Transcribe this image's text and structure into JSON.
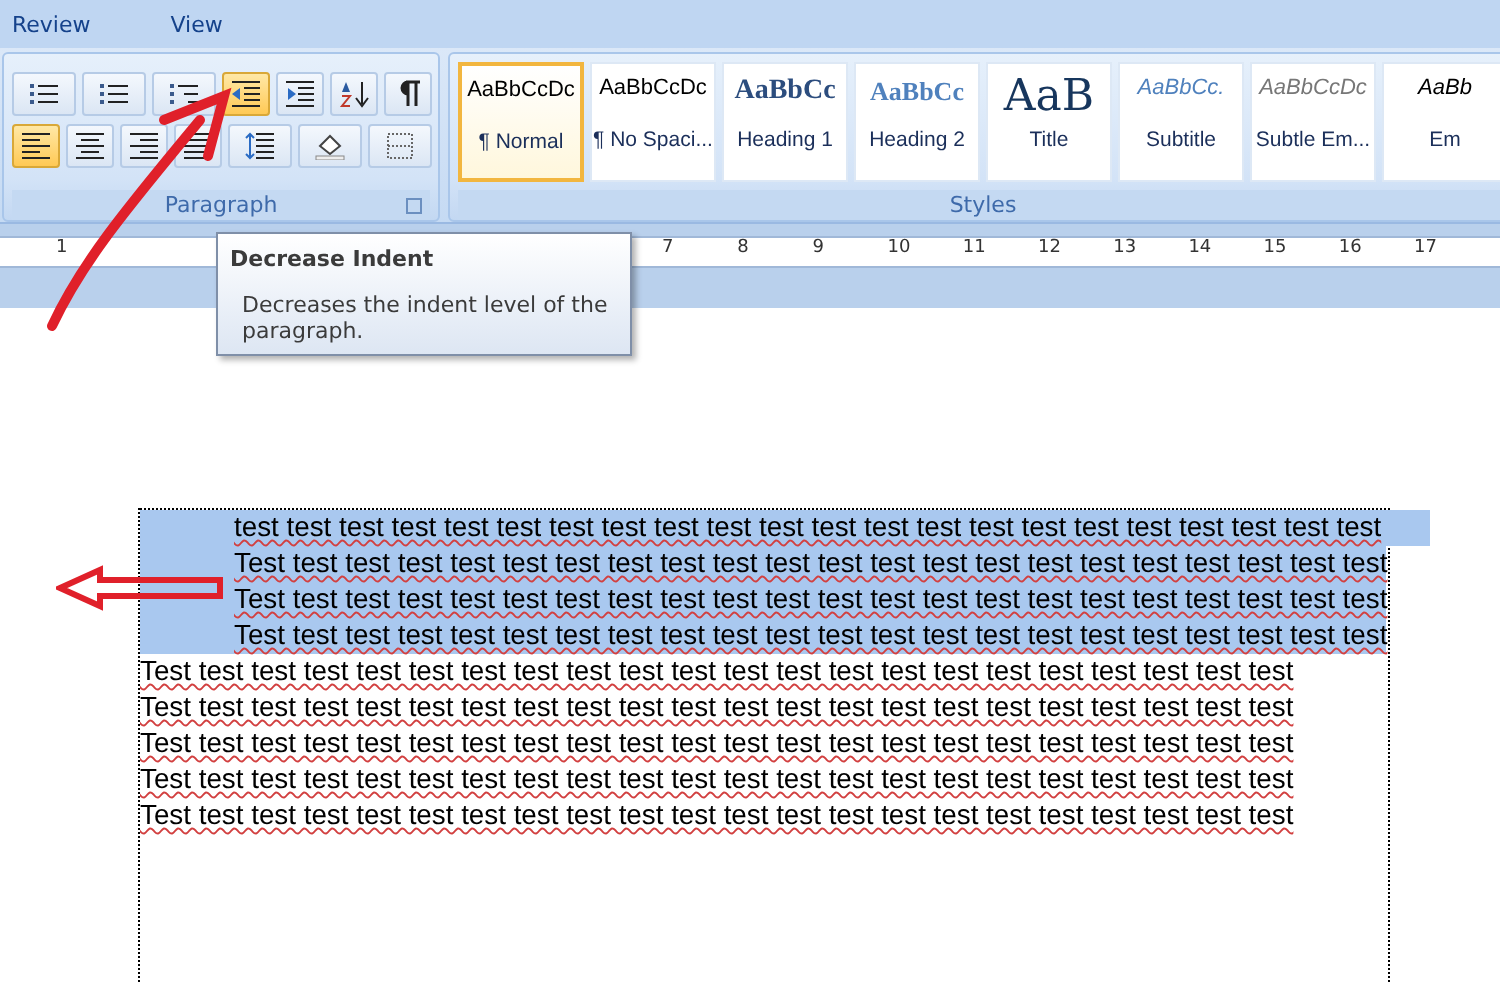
{
  "menu_tabs": [
    "Review",
    "View"
  ],
  "paragraph_group": {
    "label": "Paragraph",
    "rows": [
      [
        {
          "kind": "bullets",
          "selected": false
        },
        {
          "kind": "numbering",
          "selected": false
        },
        {
          "kind": "multilevel",
          "selected": false
        },
        {
          "kind": "decrease-indent",
          "selected": true
        },
        {
          "kind": "increase-indent",
          "selected": false
        },
        {
          "kind": "sort",
          "selected": false
        },
        {
          "kind": "pilcrow",
          "selected": false
        }
      ],
      [
        {
          "kind": "align-left",
          "selected": true
        },
        {
          "kind": "align-center",
          "selected": false
        },
        {
          "kind": "align-right",
          "selected": false
        },
        {
          "kind": "justify",
          "selected": false
        },
        {
          "kind": "line-spacing",
          "selected": false
        },
        {
          "kind": "shading",
          "selected": false
        },
        {
          "kind": "borders",
          "selected": false
        }
      ]
    ]
  },
  "styles_group": {
    "label": "Styles",
    "items": [
      {
        "sample": "AaBbCcDc",
        "label": "¶ Normal",
        "kind": "normal",
        "selected": true
      },
      {
        "sample": "AaBbCcDc",
        "label": "¶ No Spaci...",
        "kind": "normal",
        "selected": false
      },
      {
        "sample": "AaBbCc",
        "label": "Heading 1",
        "kind": "heading1",
        "selected": false
      },
      {
        "sample": "AaBbCc",
        "label": "Heading 2",
        "kind": "heading2",
        "selected": false
      },
      {
        "sample": "AaB",
        "label": "Title",
        "kind": "title",
        "selected": false
      },
      {
        "sample": "AaBbCc.",
        "label": "Subtitle",
        "kind": "subtitle",
        "selected": false
      },
      {
        "sample": "AaBbCcDc",
        "label": "Subtle Em...",
        "kind": "subtle",
        "selected": false
      },
      {
        "sample": "AaBb",
        "label": "Em",
        "kind": "emphasis",
        "selected": false
      }
    ]
  },
  "ruler": [
    "1",
    "7",
    "8",
    "9",
    "10",
    "11",
    "12",
    "13",
    "14",
    "15",
    "16",
    "17"
  ],
  "tooltip": {
    "title": "Decrease Indent",
    "description": "Decreases the indent level of the paragraph."
  },
  "document": {
    "lines": [
      {
        "text": "test test test test test test test test test test test test test test test test test test test test test test",
        "selected": true,
        "indented": true
      },
      {
        "text": "Test test test test test test test test test test test test test test test test test test test test test test",
        "selected": true,
        "indented": true
      },
      {
        "text": "Test test test test test test test test test test test test test test test test test test test test test test",
        "selected": true,
        "indented": true
      },
      {
        "text": "Test test test test test test test test test test test test test test test test test test test test test test",
        "selected": true,
        "indented": true
      },
      {
        "text": "Test test test test test test test test test test test test test test test test test test test test test test",
        "selected": false,
        "indented": false
      },
      {
        "text": "Test test test test test test test test test test test test test test test test test test test test test test",
        "selected": false,
        "indented": false
      },
      {
        "text": "Test test test test test test test test test test test test test test test test test test test test test test",
        "selected": false,
        "indented": false
      },
      {
        "text": "Test test test test test test test test test test test test test test test test test test test test test test",
        "selected": false,
        "indented": false
      },
      {
        "text": "Test test test test test test test test test test test test test test test test test test test test test test",
        "selected": false,
        "indented": false
      }
    ]
  }
}
